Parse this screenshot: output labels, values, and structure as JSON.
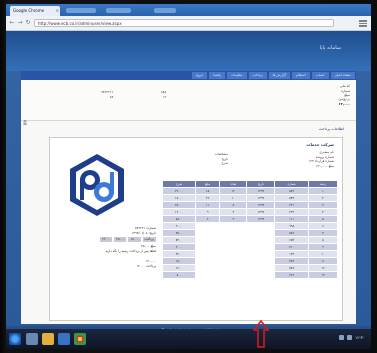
{
  "browser": {
    "tab_title": "Google Chrome",
    "address": "http://www.ecb.co.ir/adminuser/view.aspx",
    "back_glyph": "←",
    "forward_glyph": "→",
    "refresh_glyph": "↻",
    "icons": [
      "back-arrow-icon",
      "forward-arrow-icon",
      "refresh-icon",
      "menu-icon"
    ]
  },
  "site": {
    "banner_title": "سامانه پایا",
    "nav": [
      "صفحه اصلی",
      "حساب",
      "استعلام",
      "گزارش ها",
      "پرداخت",
      "تنظیمات",
      "راهنما",
      "خروج"
    ]
  },
  "user_panel": {
    "right_lines": [
      "کد ملی",
      "شماره",
      "مبلغ",
      "۱۳۹۴/۰۲"
    ],
    "right_value": "۱۲,۰۰۰",
    "middle_lines": [
      "۸۸۸",
      "۱۲"
    ],
    "left_lines": [
      "۹۸۲۲۲۱۱",
      "۸۷"
    ]
  },
  "section_heading": "اطلاعات پرداخت",
  "card": {
    "title": "شرکت خدمات",
    "subinfo": [
      "نام مشتری",
      "شماره پرونده",
      "شماره قرارداد ۱۲۳",
      "مبلغ ۲۲۰,۰۰۰"
    ],
    "center_info": [
      "مشخصات",
      "تاریخ",
      "شرح"
    ],
    "left_info": {
      "rows": [
        "شماره: ۸۷۹۲۲۱",
        "تاریخ: ۱۳۹۴/۰۱/۰۸"
      ],
      "pills": [
        "۲۲۰۰۰",
        "۲۵۰۰۰",
        "۱۸۰۰۰"
      ],
      "pills_label": "پرداخت",
      "red_note": "مبلغ ۴۵۰۰۰",
      "notes": [
        "لطفا پس از پرداخت رسید را نگه دارید",
        "۱۲۰۰۰۰",
        "پرداخت ۱۲۰۰۰"
      ]
    },
    "table": [
      {
        "cls": "h",
        "cells": [
          "شرح",
          "مبلغ",
          "تعداد",
          "تاریخ",
          "شماره",
          "ردیف"
        ]
      },
      {
        "cls": "a",
        "cells": [
          "۲۲۰۰۰",
          "۱۵",
          "۱۲",
          "۱۳۹۴",
          "۸۷۶",
          "۱"
        ]
      },
      {
        "cls": "b",
        "cells": [
          "۱۸۰۰۰",
          "۲۲",
          "۱۰",
          "۱۳۹۴",
          "۵۴۳",
          "۲"
        ]
      },
      {
        "cls": "a",
        "cells": [
          "۲۵۰۰۰",
          "۱۱",
          "۸",
          "۱۳۹۴",
          "۳۲۱",
          "۳"
        ]
      },
      {
        "cls": "b",
        "cells": [
          "۱۲۰۰۰",
          "۹",
          "۴",
          "۱۳۹۴",
          "۲۲۲",
          "۴"
        ]
      },
      {
        "cls": "a",
        "cells": [
          "۸۸۰۰",
          "۲",
          "۳",
          "۱۳۹۴",
          "۱۱۱",
          "۵"
        ]
      },
      {
        "cls": "b",
        "cells": [
          "۹۰۰۰",
          "",
          "",
          "",
          "۹۹۸",
          "۶"
        ]
      },
      {
        "cls": "a",
        "cells": [
          "۴۵۰۰",
          "",
          "",
          "",
          "۸۷۶",
          "۷"
        ]
      },
      {
        "cls": "b",
        "cells": [
          "۷۲۰۰",
          "",
          "",
          "",
          "۶۵۴",
          "۸"
        ]
      },
      {
        "cls": "a",
        "cells": [
          "۳۰۰۰",
          "",
          "",
          "",
          "۲۱۰",
          "۹"
        ]
      },
      {
        "cls": "b",
        "cells": [
          "۲۲۰۰",
          "",
          "",
          "",
          "۱۲۳",
          "۱۰"
        ]
      },
      {
        "cls": "a",
        "cells": [
          "۱۵۰۰",
          "",
          "",
          "",
          "۴۵۶",
          "۱۱"
        ]
      },
      {
        "cls": "b",
        "cells": [
          "۱۲۰۰",
          "",
          "",
          "",
          "۷۸۹",
          "۱۲"
        ]
      },
      {
        "cls": "a",
        "cells": [
          "۸۰۰",
          "",
          "",
          "",
          "۳۶۹",
          "۱۳"
        ]
      }
    ]
  },
  "footer_note": "برای اطلاعات بیشتر با پشتیبانی تماس بگیرید",
  "taskbar": {
    "clock": "۱۲:۳۰",
    "colors": {
      "accent": "#2b63ad",
      "arrow": "#d21d1d"
    }
  }
}
